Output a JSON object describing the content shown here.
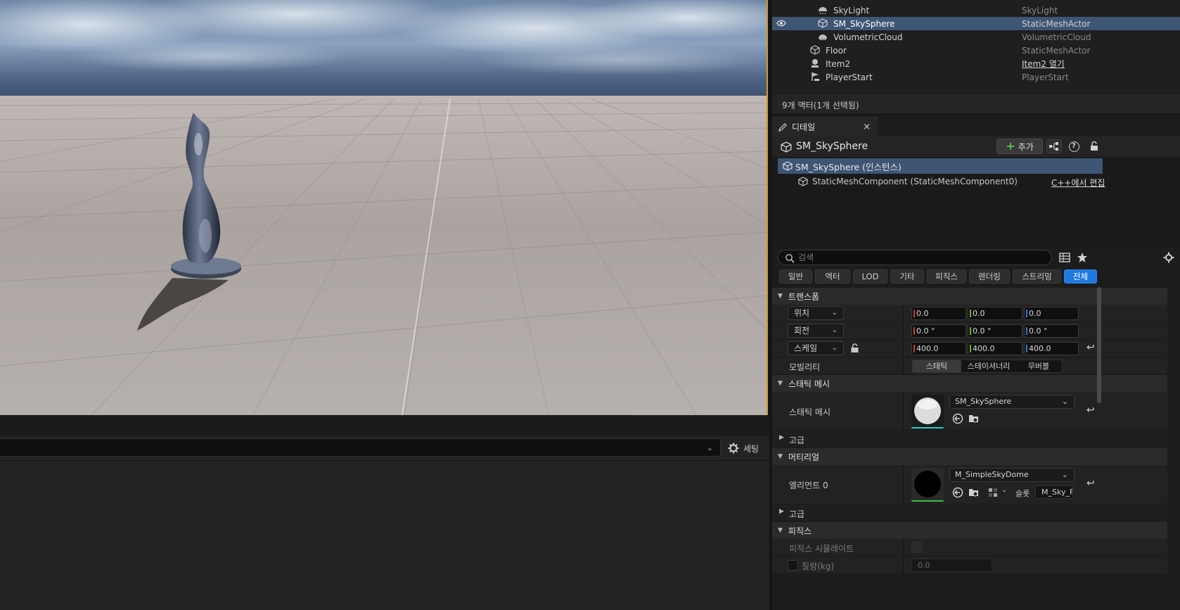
{
  "outliner": {
    "rows": [
      {
        "label": "SkyLight",
        "type": "SkyLight"
      },
      {
        "label": "SM_SkySphere",
        "type": "StaticMeshActor"
      },
      {
        "label": "VolumetricCloud",
        "type": "VolumetricCloud"
      },
      {
        "label": "Floor",
        "type": "StaticMeshActor"
      },
      {
        "label": "Item2",
        "type": "Item2 열기"
      },
      {
        "label": "PlayerStart",
        "type": "PlayerStart"
      }
    ],
    "status": "9개 액터(1개 선택됨)"
  },
  "details": {
    "tab_label": "디테일",
    "tab_close": "×",
    "actor_name": "SM_SkySphere",
    "add_label": "추가",
    "add_plus": "+",
    "help_glyph": "?",
    "component_root": "SM_SkySphere (인스턴스)",
    "component_child": "StaticMeshComponent (StaticMeshComponent0)",
    "cpp_link": "C++에서 편집",
    "search_placeholder": "검색",
    "filter_tabs": [
      "일반",
      "액터",
      "LOD",
      "기타",
      "피직스",
      "렌더링",
      "스트리밍",
      "전체"
    ],
    "active_filter": "전체"
  },
  "transform": {
    "category": "트랜스폼",
    "location": {
      "label": "위치",
      "x": "0.0",
      "y": "0.0",
      "z": "0.0"
    },
    "rotation": {
      "label": "회전",
      "x": "0.0 °",
      "y": "0.0 °",
      "z": "0.0 °"
    },
    "scale": {
      "label": "스케일",
      "x": "400.0",
      "y": "400.0",
      "z": "400.0"
    },
    "mobility": {
      "label": "모빌리티",
      "options": [
        "스태틱",
        "스테이셔너리",
        "무버블"
      ],
      "selected": "스태틱"
    }
  },
  "static_mesh": {
    "category": "스태틱 메시",
    "label": "스태틱 메시",
    "value": "SM_SkySphere",
    "advanced": "고급"
  },
  "materials": {
    "category": "머티리얼",
    "label": "엘리먼트 0",
    "value": "M_SimpleSkyDome",
    "slot_label": "슬롯",
    "slot_value": "M_Sky_F",
    "advanced": "고급"
  },
  "physics": {
    "category": "피직스",
    "simulate_label": "피직스 시뮬레이트",
    "mass_label": "질량(kg)",
    "mass_value": "0.0"
  },
  "bottom": {
    "settings_label": "세팅",
    "dropdown_glyph": "⌄"
  },
  "colors": {
    "selection": "#3e5574",
    "accent_active": "#1f7ae0",
    "viewport_border": "#d59a2e"
  }
}
